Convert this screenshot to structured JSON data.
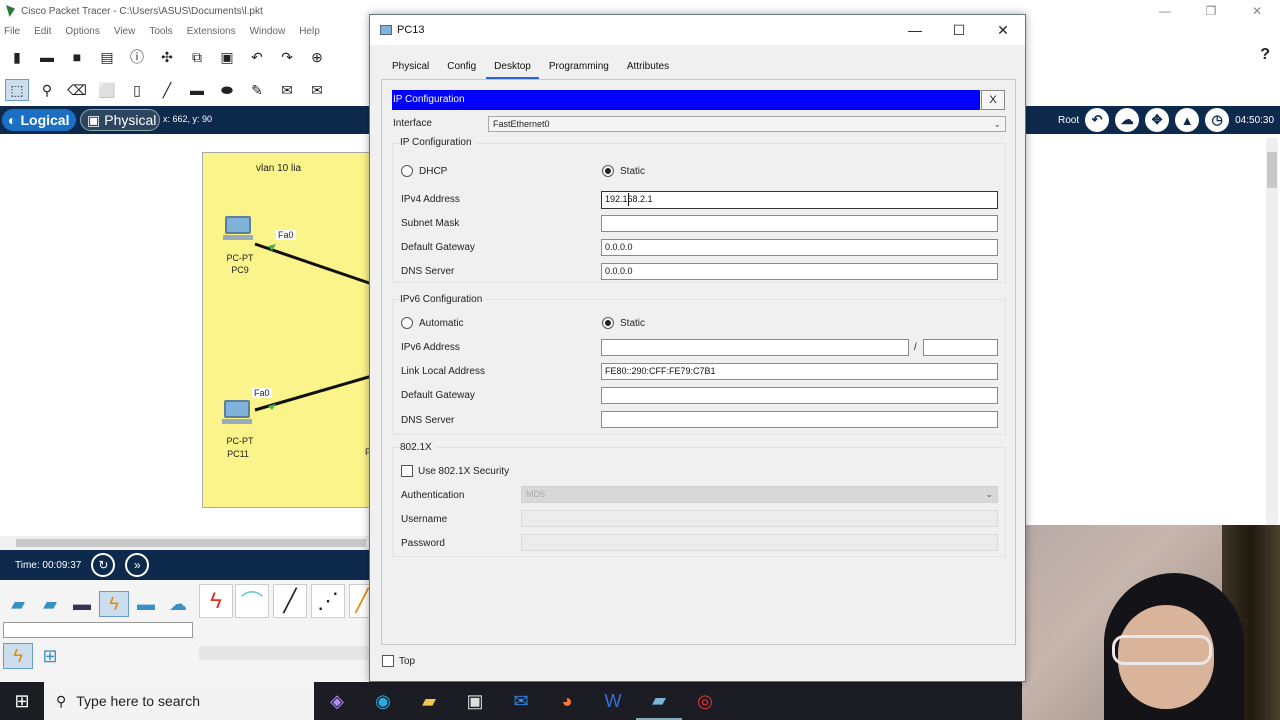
{
  "app": {
    "title": "Cisco Packet Tracer - C:\\Users\\ASUS\\Documents\\l.pkt",
    "menu": [
      "File",
      "Edit",
      "Options",
      "View",
      "Tools",
      "Extensions",
      "Window",
      "Help"
    ],
    "help_symbol": "?"
  },
  "modebar": {
    "logical": "Logical",
    "physical": "Physical",
    "coords": "x: 662, y: 90",
    "root": "Root",
    "time": "04:50:30"
  },
  "workspace": {
    "cluster_label": "vlan 10 lia",
    "nodes": [
      {
        "type": "PC-PT",
        "name": "PC9",
        "port": "Fa0"
      },
      {
        "type": "PC-PT",
        "name": "PC11",
        "port": "Fa0"
      },
      {
        "partial_label": "P"
      }
    ]
  },
  "timebar": {
    "time_label": "Time: 00:09:37"
  },
  "taskbar": {
    "search_placeholder": "Type here to search"
  },
  "dialog": {
    "title": "PC13",
    "tabs": [
      "Physical",
      "Config",
      "Desktop",
      "Programming",
      "Attributes"
    ],
    "active_tab": "Desktop",
    "ip_config": {
      "header": "IP Configuration",
      "close": "X",
      "interface_label": "Interface",
      "interface_value": "FastEthernet0",
      "ipv4_group": "IP Configuration",
      "dhcp": "DHCP",
      "static": "Static",
      "ipv4_mode": "Static",
      "ipv4_address_label": "IPv4 Address",
      "ipv4_address": "192.168.2.1",
      "subnet_mask_label": "Subnet Mask",
      "subnet_mask": "",
      "gateway_label": "Default Gateway",
      "gateway": "0.0.0.0",
      "dns_label": "DNS Server",
      "dns": "0.0.0.0",
      "ipv6_group": "IPv6 Configuration",
      "automatic": "Automatic",
      "ipv6_mode": "Static",
      "ipv6_address_label": "IPv6 Address",
      "ipv6_address": "",
      "ipv6_slash": "/",
      "ipv6_prefix": "",
      "link_local_label": "Link Local Address",
      "link_local": "FE80::290:CFF:FE79:C7B1",
      "ipv6_gateway_label": "Default Gateway",
      "ipv6_gateway": "",
      "ipv6_dns_label": "DNS Server",
      "ipv6_dns": "",
      "dot1x_group": "802.1X",
      "use_dot1x": "Use 802.1X Security",
      "auth_label": "Authentication",
      "auth_value": "MD5",
      "username_label": "Username",
      "password_label": "Password"
    },
    "top_label": "Top"
  },
  "colors": {
    "ip_header_bg": "#0000ff",
    "modebar_bg": "#0d2a4d",
    "cluster_bg": "#fbf48a"
  }
}
